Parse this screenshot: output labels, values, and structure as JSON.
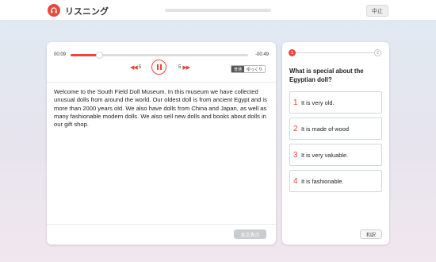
{
  "header": {
    "title": "リスニング",
    "stop_label": "中止",
    "accent_color": "#e8473c"
  },
  "player": {
    "elapsed": "00:09",
    "remaining": "-00:49",
    "progress_fraction": 0.16,
    "rewind_label": "5",
    "forward_label": "5",
    "speed_options": [
      "普通",
      "ゆっくり"
    ],
    "selected_speed": "普通",
    "icons": [
      "rewind-icon",
      "pause-icon",
      "fast-forward-icon"
    ]
  },
  "transcript": {
    "text": "Welcome to the South Field Doll Museum. In this museum we have collected unusual dolls from around the world. Our oldest doll is from ancient Egypt and is more than 2000 years old. We also have dolls from China and Japan, as well as many fashionable modern dolls. We also sell new dolls and books about dolls in our gift shop."
  },
  "main_footer": {
    "show_text_label": "本文表示"
  },
  "question_panel": {
    "steps": [
      "1",
      "2"
    ],
    "current_step": 1,
    "question": "What is special about the Egyptian doll?",
    "options": [
      {
        "num": "1",
        "text": "It is very old."
      },
      {
        "num": "2",
        "text": "It is made of wood"
      },
      {
        "num": "3",
        "text": "It is very valuable."
      },
      {
        "num": "4",
        "text": "It is fashionable."
      }
    ],
    "translate_label": "和訳"
  }
}
